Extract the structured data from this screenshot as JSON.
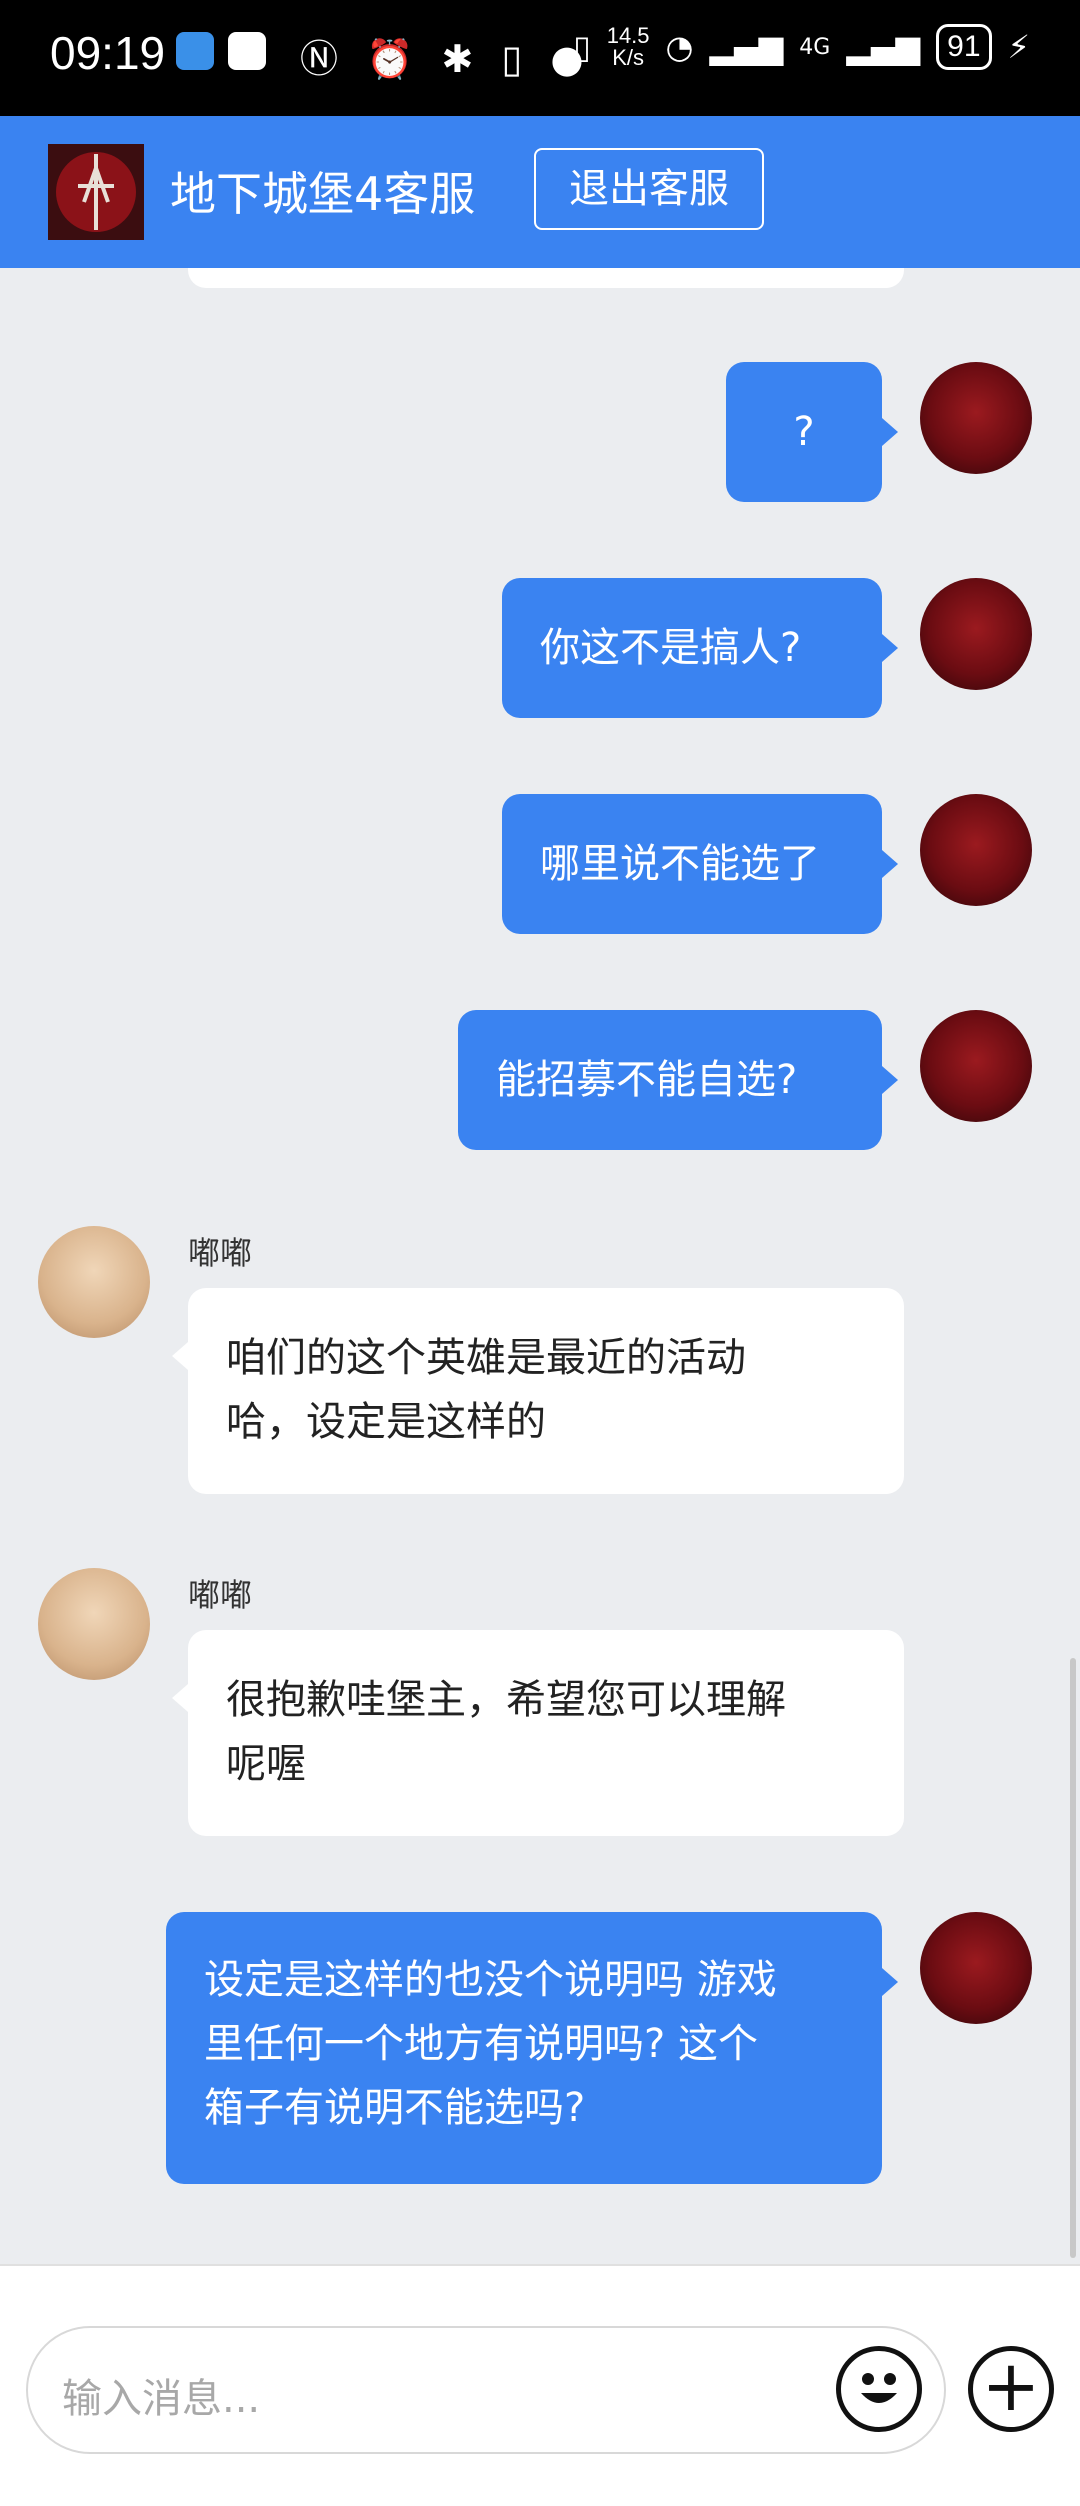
{
  "status_bar": {
    "time": "09:19",
    "glyphs": "Ⓝ ⏰ ✱ ▯ ●",
    "speed_top": "14.5",
    "speed_bottom": "K/s",
    "network": "4G",
    "battery": "91"
  },
  "header": {
    "title": "地下城堡4客服",
    "exit_label": "退出客服",
    "color": "#3a83f1"
  },
  "messages": [
    {
      "side": "me",
      "text": "?"
    },
    {
      "side": "me",
      "text": "你这不是搞人?"
    },
    {
      "side": "me",
      "text": "哪里说不能选了"
    },
    {
      "side": "me",
      "text": "能招募不能自选?"
    },
    {
      "side": "them",
      "name": "嘟嘟",
      "lines": [
        "咱们的这个英雄是最近的活动",
        "哈，设定是这样的"
      ]
    },
    {
      "side": "them",
      "name": "嘟嘟",
      "lines": [
        "很抱歉哇堡主，希望您可以理解",
        "呢喔"
      ]
    },
    {
      "side": "me",
      "lines": [
        "设定是这样的也没个说明吗 游戏",
        "里任何一个地方有说明吗? 这个",
        "箱子有说明不能选吗?"
      ]
    }
  ],
  "input": {
    "placeholder": "输入消息...",
    "emoji_icon": "smiley-face-icon",
    "plus_icon": "plus-circle-icon"
  }
}
